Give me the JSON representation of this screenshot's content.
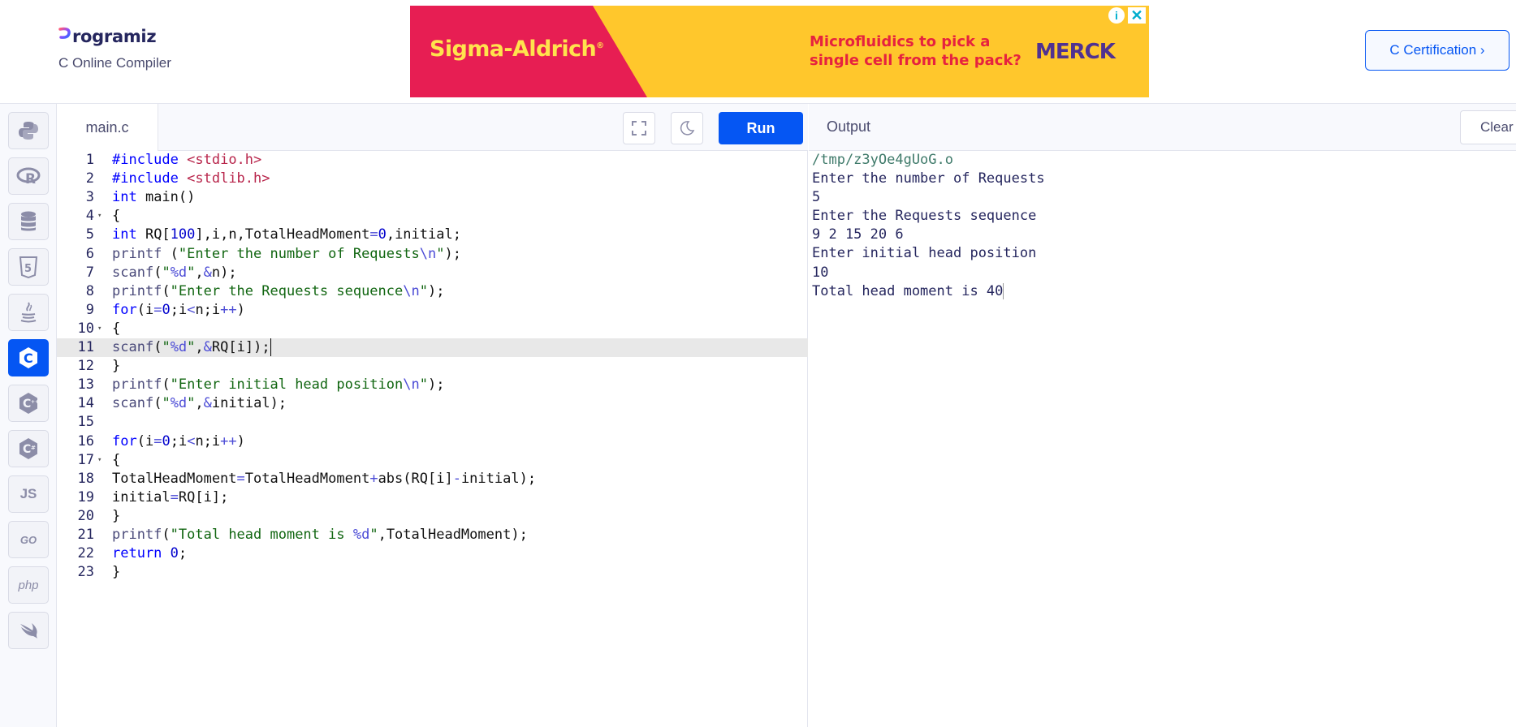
{
  "header": {
    "brand": "rogramiz",
    "subtitle": "C Online Compiler",
    "certification_button": "C Certification ›"
  },
  "ad": {
    "brand": "Sigma-Aldrich",
    "brand_mark": "®",
    "text": "Microfluidics to pick a single cell from the pack?",
    "logo": "MERCK",
    "info_label": "i",
    "close_label": "✕"
  },
  "languages": [
    {
      "name": "python",
      "label": ""
    },
    {
      "name": "r",
      "label": ""
    },
    {
      "name": "sql",
      "label": ""
    },
    {
      "name": "html",
      "label": ""
    },
    {
      "name": "java",
      "label": ""
    },
    {
      "name": "c",
      "label": "",
      "active": true
    },
    {
      "name": "cpp",
      "label": ""
    },
    {
      "name": "csharp",
      "label": ""
    },
    {
      "name": "javascript",
      "label": "JS"
    },
    {
      "name": "go",
      "label": "GO"
    },
    {
      "name": "php",
      "label": "php"
    },
    {
      "name": "swift",
      "label": ""
    }
  ],
  "editor": {
    "tab_label": "main.c",
    "run_label": "Run",
    "active_line": 11,
    "lines": [
      "#include <stdio.h>",
      "#include <stdlib.h>",
      "int main()",
      "{",
      "int RQ[100],i,n,TotalHeadMoment=0,initial;",
      "printf (\"Enter the number of Requests\\n\");",
      "scanf(\"%d\",&n);",
      "printf(\"Enter the Requests sequence\\n\");",
      "for(i=0;i<n;i++)",
      "{",
      "scanf(\"%d\",&RQ[i]);",
      "}",
      "printf(\"Enter initial head position\\n\");",
      "scanf(\"%d\",&initial);",
      "",
      "for(i=0;i<n;i++)",
      "{",
      "TotalHeadMoment=TotalHeadMoment+abs(RQ[i]-initial);",
      "initial=RQ[i];",
      "}",
      "printf(\"Total head moment is %d\",TotalHeadMoment);",
      "return 0;",
      "}"
    ]
  },
  "output": {
    "title": "Output",
    "clear_label": "Clear",
    "lines": [
      "/tmp/z3yOe4gUoG.o",
      "Enter the number of Requests",
      "5",
      "Enter the Requests sequence",
      "9 2 15 20 6",
      "Enter initial head position",
      "10",
      "Total head moment is 40"
    ]
  },
  "colors": {
    "accent": "#0556f3",
    "ad_left": "#e71e53",
    "ad_right": "#ffc72c"
  }
}
